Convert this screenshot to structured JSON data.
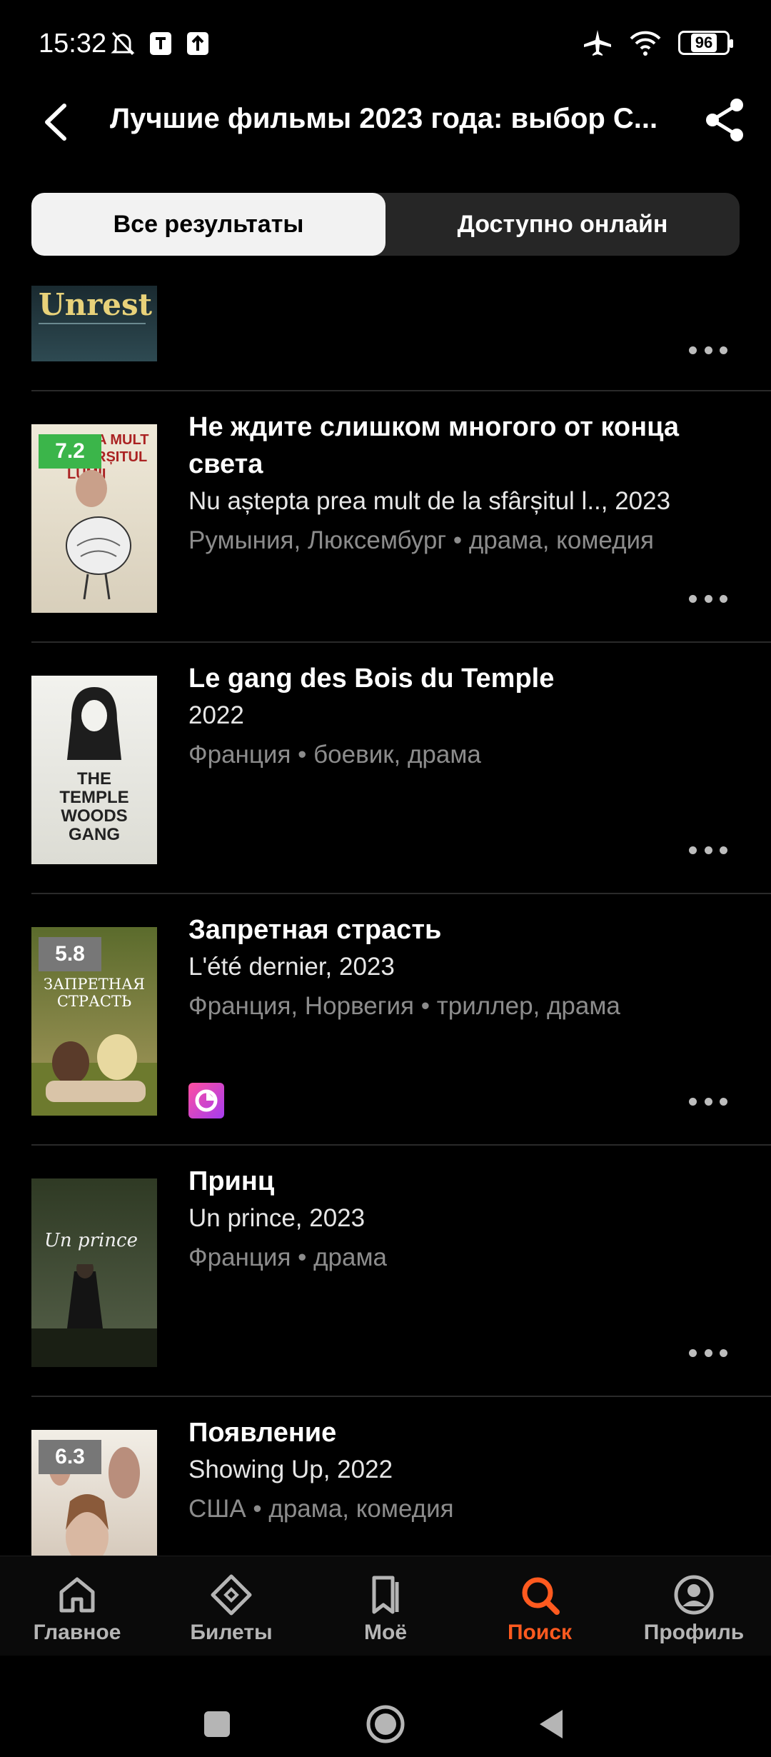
{
  "status": {
    "time": "15:32",
    "battery": "96",
    "icons_left": [
      "mute-bell-icon",
      "shield-icon",
      "upload-icon"
    ],
    "icons_right": [
      "airplane-icon",
      "wifi-icon",
      "battery-icon"
    ]
  },
  "header": {
    "title": "Лучшие фильмы 2023 года: выбор С..."
  },
  "tabs": [
    {
      "label": "Все результаты",
      "active": true
    },
    {
      "label": "Доступно онлайн",
      "active": false
    }
  ],
  "movies": [
    {
      "poster_text": "Unrest",
      "poster_colors": [
        "#1a2a30",
        "#2e4a52"
      ],
      "title": "",
      "original": "",
      "meta": "",
      "rating": ""
    },
    {
      "title": "Не ждите слишком многого от конца света",
      "original": "Nu așteptа prea mult de la sfârșitul l.., 2023",
      "meta": "Румыния, Люксембург • драма, комедия",
      "rating": "7.2",
      "rating_color": "#3bb54a",
      "poster_text": "PREA MULT SFÂRȘITUL LUMII",
      "poster_colors": [
        "#efe9d9",
        "#d8cfbb"
      ]
    },
    {
      "title": "Le gang des Bois du Temple",
      "original": "2022",
      "meta": "Франция • боевик, драма",
      "rating": "",
      "poster_text": "THE TEMPLE WOODS GANG",
      "poster_colors": [
        "#f2f2ee",
        "#dcdcd4"
      ]
    },
    {
      "title": "Запретная страсть",
      "original": "L'été dernier, 2023",
      "meta": "Франция, Норвегия • триллер, драма",
      "rating": "5.8",
      "rating_color": "#777777",
      "poster_text": "ЗАПРЕТНАЯ СТРАСТЬ",
      "poster_colors": [
        "#5b6b2c",
        "#a89a5e"
      ],
      "service": "streaming-service-icon"
    },
    {
      "title": "Принц",
      "original": "Un prince, 2023",
      "meta": "Франция • драма",
      "rating": "",
      "poster_text": "Un prince",
      "poster_colors": [
        "#2f3a24",
        "#56614a"
      ]
    },
    {
      "title": "Появление",
      "original": "Showing Up, 2022",
      "meta": "США • драма, комедия",
      "rating": "6.3",
      "rating_color": "#777777",
      "poster_text": "",
      "poster_colors": [
        "#c9b9a8",
        "#8d7b6a"
      ]
    }
  ],
  "nav": [
    {
      "label": "Главное",
      "icon": "home-icon",
      "active": false
    },
    {
      "label": "Билеты",
      "icon": "ticket-icon",
      "active": false
    },
    {
      "label": "Моё",
      "icon": "bookmark-icon",
      "active": false
    },
    {
      "label": "Поиск",
      "icon": "search-icon",
      "active": true
    },
    {
      "label": "Профиль",
      "icon": "profile-icon",
      "active": false
    }
  ],
  "colors": {
    "accent": "#ff5a1f",
    "background": "#000000",
    "rating_good": "#3bb54a",
    "rating_neutral": "#777777"
  }
}
